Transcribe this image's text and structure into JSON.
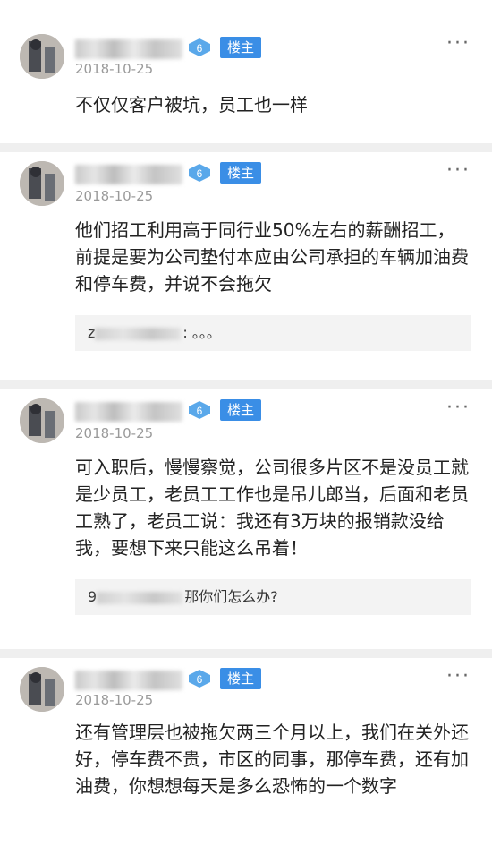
{
  "posts": [
    {
      "author_level": "6",
      "badge": "楼主",
      "date": "2018-10-25",
      "text": "不仅仅客户被坑，员工也一样",
      "more_icon": "more-dots-icon"
    },
    {
      "author_level": "6",
      "badge": "楼主",
      "date": "2018-10-25",
      "text": "他们招工利用高于同行业50%左右的薪酬招工，前提是要为公司垫付本应由公司承担的车辆加油费和停车费，并说不会拖欠",
      "reply": {
        "prefix": "z",
        "text": ": 。。。"
      }
    },
    {
      "author_level": "6",
      "badge": "楼主",
      "date": "2018-10-25",
      "text": "可入职后，慢慢察觉，公司很多片区不是没员工就是少员工，老员工工作也是吊儿郎当，后面和老员工熟了，老员工说：我还有3万块的报销款没给我，要想下来只能这么吊着！",
      "reply": {
        "prefix": "9",
        "text": "那你们怎么办?"
      }
    },
    {
      "author_level": "6",
      "badge": "楼主",
      "date": "2018-10-25",
      "text": "还有管理层也被拖欠两三个月以上，我们在关外还好，停车费不贵，市区的同事，那停车费，还有加油费，你想想每天是多么恐怖的一个数字"
    }
  ],
  "colors": {
    "badge_bg": "#3a8ee6",
    "level_bg": "#5aa8ea",
    "date": "#9a9a9a",
    "reply_bg": "#f3f3f3"
  }
}
